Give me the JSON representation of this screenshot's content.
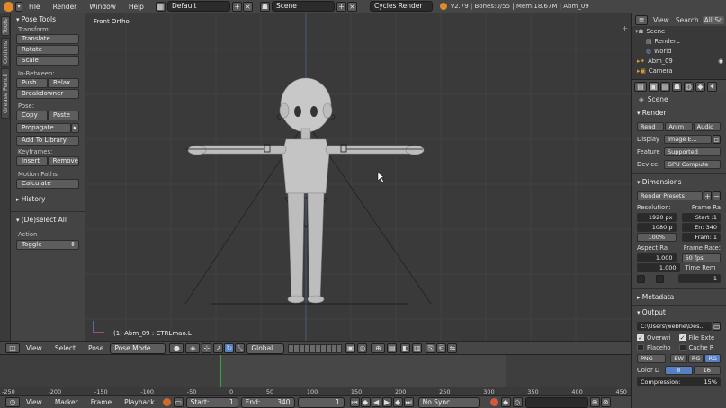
{
  "menubar": {
    "items": [
      "File",
      "Render",
      "Window",
      "Help"
    ],
    "layout": "Default",
    "scene": "Scene",
    "engine": "Cycles Render",
    "status": "v2.79 | Bones:0/55 | Mem:18.67M | Abm_09"
  },
  "vtabs": [
    "Tools",
    "Options",
    "Grease Pencil"
  ],
  "toolshelf": {
    "panel_title": "Pose Tools",
    "transform_label": "Transform:",
    "translate": "Translate",
    "rotate": "Rotate",
    "scale": "Scale",
    "inbetween_label": "In-Between:",
    "push": "Push",
    "relax": "Relax",
    "breakdowner": "Breakdowner",
    "pose_label": "Pose:",
    "copy": "Copy",
    "paste": "Paste",
    "propagate": "Propagate",
    "add_library": "Add To Library",
    "keyframes_label": "Keyframes:",
    "insert": "Insert",
    "remove": "Remove",
    "motion_label": "Motion Paths:",
    "calculate": "Calculate",
    "history": "History",
    "operator_title": "(De)select All",
    "action_label": "Action",
    "action_value": "Toggle"
  },
  "viewport": {
    "view_name": "Front Ortho",
    "object_info": "(1) Abm_09 : CTRLmao.L"
  },
  "header3d": {
    "menus": [
      "View",
      "Select",
      "Pose"
    ],
    "mode": "Pose Mode",
    "orientation": "Global"
  },
  "timeline": {
    "ticks": [
      "-250",
      "-200",
      "-150",
      "-100",
      "-50",
      "0",
      "50",
      "100",
      "150",
      "200",
      "250",
      "300",
      "350",
      "400",
      "450"
    ],
    "footer_menus": [
      "View",
      "Marker",
      "Frame",
      "Playback"
    ],
    "start": "Start:",
    "start_val": "1",
    "end": "End:",
    "end_val": "340",
    "current": "1",
    "sync": "No Sync"
  },
  "outliner": {
    "view": "View",
    "search": "Search",
    "all": "All Sc",
    "items": [
      "Scene",
      "RenderL",
      "World",
      "Abm_09",
      "Camera"
    ]
  },
  "properties": {
    "scene": "Scene",
    "render_head": "Render",
    "rend": "Rend",
    "anim": "Anim",
    "audio": "Audio",
    "display_label": "Display",
    "display_val": "Image E...",
    "feature_label": "Feature",
    "feature_val": "Supported",
    "device_label": "Device:",
    "device_val": "GPU Compute",
    "dimensions_head": "Dimensions",
    "presets": "Render Presets",
    "resolution": "Resolution:",
    "frame_range": "Frame Ra",
    "res_x": "1920 px",
    "res_y": "1080 p",
    "res_pct": "100%",
    "start": "Start :1",
    "end": "En: 340",
    "frame": "Fram: 1",
    "aspect": "Aspect Ra",
    "frame_rate": "Frame Rate:",
    "aspect_x": "1.000",
    "aspect_y": "1.000",
    "fps": "60 fps",
    "time_rem": "Time Rem",
    "time_val": "1",
    "metadata_head": "Metadata",
    "output_head": "Output",
    "path": "C:\\Users\\webhe\\Des...",
    "overwrite": "Overwri",
    "file_ext": "File Exte",
    "placeholder": "Placeho",
    "cache": "Cache R",
    "format": "PNG",
    "bw": "BW",
    "rgb": "RG",
    "rgba": "RG",
    "color_depth": "Color D",
    "depth8": "8",
    "depth16": "16",
    "compression": "Compression:",
    "compression_val": "15%"
  },
  "colors": {
    "accent_blue": "#5680c2",
    "playhead": "#3aa53a",
    "ui_dark": "#393939"
  }
}
